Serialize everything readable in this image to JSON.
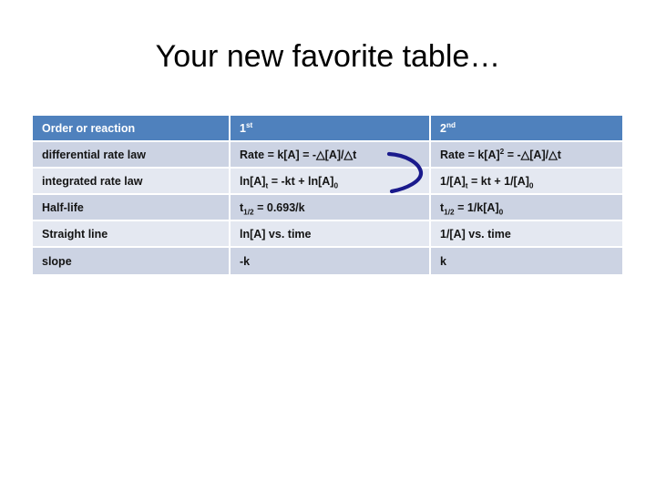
{
  "slide": {
    "title": "Your new favorite table…"
  },
  "table": {
    "columns": [
      "Order or reaction",
      "1st",
      "2nd"
    ],
    "column_superscripts": [
      "",
      "st",
      "nd"
    ],
    "column_bases": [
      "Order or reaction",
      "1",
      "2"
    ],
    "rows": [
      {
        "label": "differential rate law",
        "first_order": "Rate = k[A] = -△[A]/△t",
        "second_order": "Rate = k[A]2 = -△[A]/△t"
      },
      {
        "label": "integrated rate law",
        "first_order": "ln[A]t = -kt + ln[A]0",
        "second_order": "1/[A]t = kt + 1/[A]0"
      },
      {
        "label": "Half-life",
        "first_order": "t1/2 = 0.693/k",
        "second_order": "t1/2 = 1/k[A]0"
      },
      {
        "label": "Straight line",
        "first_order": "ln[A] vs. time",
        "second_order": "1/[A] vs. time"
      },
      {
        "label": "slope",
        "first_order": "-k",
        "second_order": "k"
      }
    ]
  },
  "annotation": {
    "shape": "hand-drawn-curly-bracket",
    "color": "#1a1a8c"
  },
  "colors": {
    "header_blue": "#4f81bd",
    "row_even": "#ccd3e3",
    "row_odd": "#e4e8f1",
    "text": "#141414",
    "header_text": "#ffffff",
    "annotation": "#1a1a8c",
    "background": "#ffffff"
  }
}
